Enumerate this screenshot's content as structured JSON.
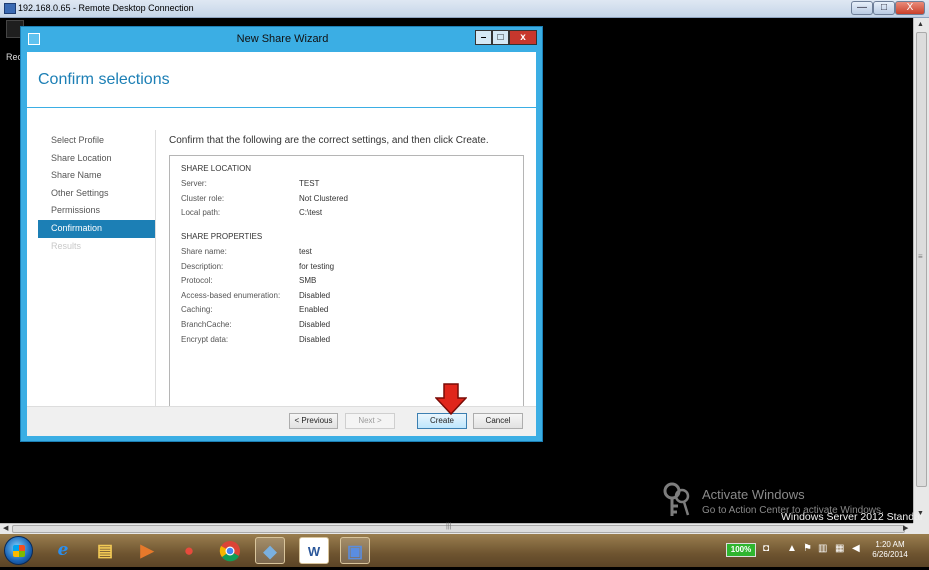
{
  "rdp": {
    "title": "192.168.0.65 - Remote Desktop Connection",
    "min": "—",
    "max": "□",
    "close": "X"
  },
  "desktop": {
    "rec_label": "Rec"
  },
  "wizard": {
    "title": "New Share Wizard",
    "min": "–",
    "max": "□",
    "close": "x",
    "heading": "Confirm selections",
    "nav": [
      "Select Profile",
      "Share Location",
      "Share Name",
      "Other Settings",
      "Permissions",
      "Confirmation",
      "Results"
    ],
    "instruction": "Confirm that the following are the correct settings, and then click Create.",
    "share_location": {
      "heading": "SHARE LOCATION",
      "rows": [
        {
          "label": "Server:",
          "value": "TEST"
        },
        {
          "label": "Cluster role:",
          "value": "Not Clustered"
        },
        {
          "label": "Local path:",
          "value": "C:\\test"
        }
      ]
    },
    "share_properties": {
      "heading": "SHARE PROPERTIES",
      "rows": [
        {
          "label": "Share name:",
          "value": "test"
        },
        {
          "label": "Description:",
          "value": "for testing"
        },
        {
          "label": "Protocol:",
          "value": "SMB"
        },
        {
          "label": "Access-based enumeration:",
          "value": "Disabled"
        },
        {
          "label": "Caching:",
          "value": "Enabled"
        },
        {
          "label": "BranchCache:",
          "value": "Disabled"
        },
        {
          "label": "Encrypt data:",
          "value": "Disabled"
        }
      ]
    },
    "buttons": {
      "previous": "< Previous",
      "next": "Next >",
      "create": "Create",
      "cancel": "Cancel"
    }
  },
  "watermark": {
    "title": "Activate Windows",
    "subtitle": "Go to Action Center to activate Windows.",
    "edition": "Windows Server 2012 Standar"
  },
  "taskbar": {
    "apps": [
      "ie-icon",
      "explorer-icon",
      "media-player-icon",
      "app-icon",
      "chrome-icon",
      "app-icon",
      "word-icon",
      "remote-desktop-icon"
    ],
    "ie_glyph": "e",
    "word_glyph": "W",
    "battery": "100%",
    "time": "1:20 AM",
    "date": "6/26/2014"
  },
  "colors": {
    "accent": "#3baee4",
    "heading": "#1c7fb5",
    "close_red": "#c7372d",
    "pointer_red": "#e0261b"
  }
}
